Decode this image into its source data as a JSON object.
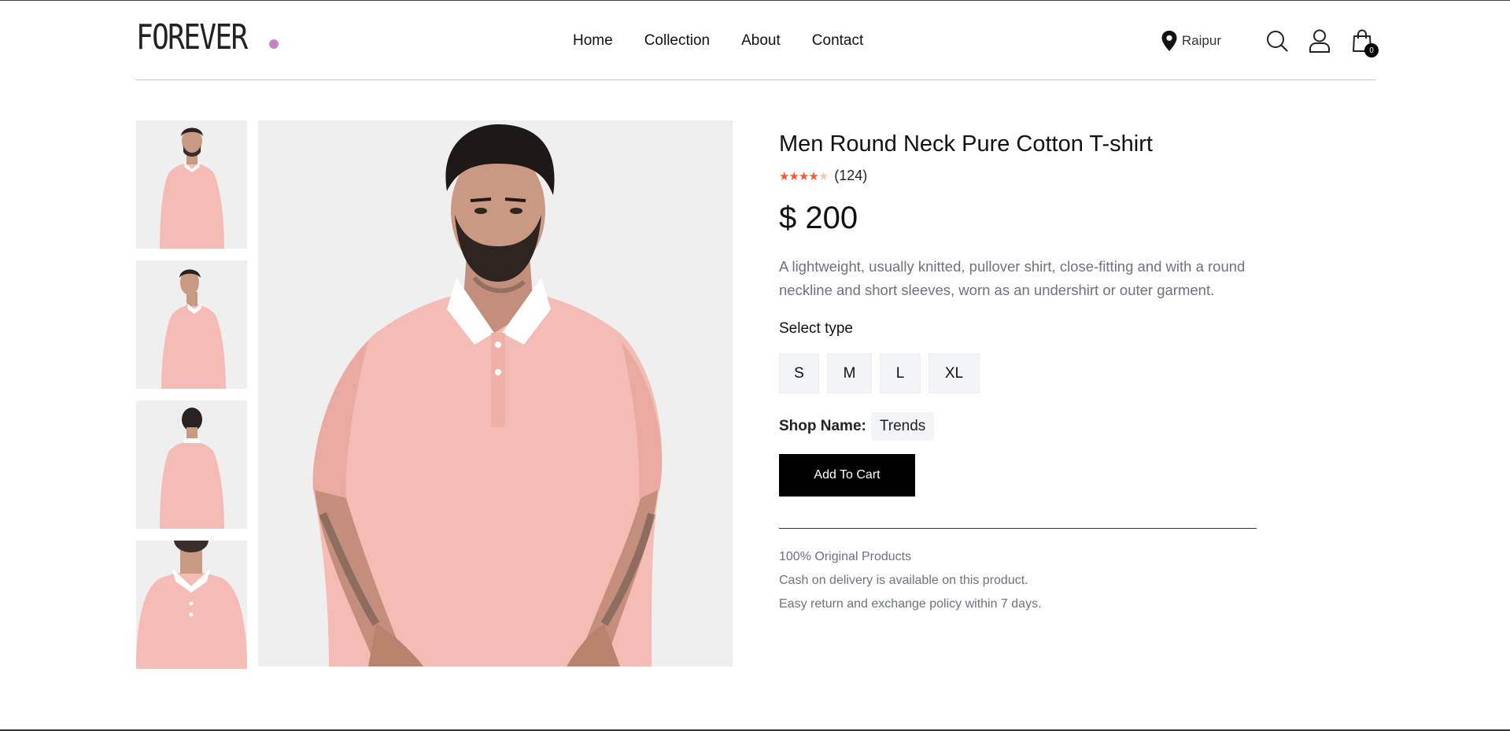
{
  "header": {
    "logo_text": "FOREVER",
    "nav": [
      "Home",
      "Collection",
      "About",
      "Contact"
    ],
    "location": "Raipur",
    "cart_count": "0",
    "accent_color": "#c586c0"
  },
  "product": {
    "title": "Men Round Neck Pure Cotton T-shirt",
    "rating": 4,
    "rating_max": 5,
    "review_count": "(124)",
    "price": "$ 200",
    "description": "A lightweight, usually knitted, pullover shirt, close-fitting and with a round neckline and short sleeves, worn as an undershirt or outer garment.",
    "select_label": "Select type",
    "sizes": [
      "S",
      "M",
      "L",
      "XL"
    ],
    "shop_label": "Shop Name:",
    "shop_name": "Trends",
    "add_to_cart": "Add To Cart",
    "policies": [
      "100% Original Products",
      "Cash on delivery is available on this product.",
      "Easy return and exchange policy within 7 days."
    ],
    "shirt_color": "#f4bcb4",
    "star_color": "#ff5533"
  }
}
